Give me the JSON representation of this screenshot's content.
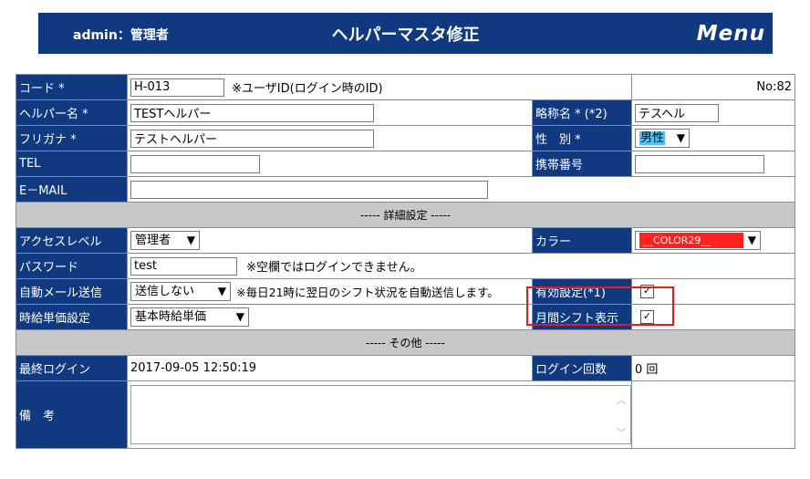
{
  "header": {
    "user": "admin：管理者",
    "title": "ヘルパーマスタ修正",
    "menu": "Menu"
  },
  "labels": {
    "code": "コード *",
    "helper_name": "ヘルパー名 *",
    "short_name": "略称名 * (*2)",
    "furigana": "フリガナ *",
    "gender": "性　別 *",
    "tel": "TEL",
    "mobile": "携帯番号",
    "email": "E－MAIL",
    "access_level": "アクセスレベル",
    "color": "カラー",
    "password": "パスワード",
    "auto_mail": "自動メール送信",
    "valid_setting": "有効設定(*1)",
    "hourly_rate": "時給単価設定",
    "monthly_shift": "月間シフト表示",
    "last_login": "最終ログイン",
    "login_count": "ログイン回数",
    "remarks": "備　考"
  },
  "values": {
    "code": "H-013",
    "code_note": "※ユーザID(ログイン時のID)",
    "no": "No:82",
    "helper_name": "TESTヘルパー",
    "short_name": "テスヘル",
    "furigana": "テストヘルパー",
    "gender": "男性",
    "tel": "",
    "mobile": "",
    "email": "",
    "access_level": "管理者",
    "color": "__COLOR29__",
    "password": "test",
    "password_note": "※空欄ではログインできません。",
    "auto_mail": "送信しない",
    "auto_mail_note": "※毎日21時に翌日のシフト状況を自動送信します。",
    "hourly_rate": "基本時給単価",
    "last_login": "2017-09-05 12:50:19",
    "login_count": "0 回",
    "remarks": ""
  },
  "sections": {
    "detail": "----- 詳細設定 -----",
    "other": "----- その他 -----"
  },
  "checkboxes": {
    "valid_setting": true,
    "monthly_shift": true
  },
  "colors": {
    "header_bg": "#10397f",
    "label_bg": "#10397f",
    "section_bg": "#c8c8c8",
    "highlight": "#e21b1b",
    "color_swatch": "#ff2020"
  }
}
